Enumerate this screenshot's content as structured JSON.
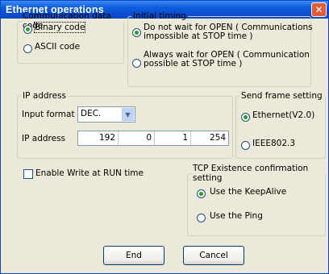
{
  "window": {
    "title": "Ethernet operations",
    "close_glyph": "✕"
  },
  "communication": {
    "legend": "Communication data code",
    "options": [
      "Binary code",
      "ASCII code"
    ],
    "selected": "Binary code"
  },
  "initial_timing": {
    "legend": "Initial timing",
    "options": [
      {
        "line1": "Do not wait for OPEN ( Communications",
        "line2": "impossible at STOP time )"
      },
      {
        "line1": "Always wait for OPEN ( Communication",
        "line2": "possible at STOP time )"
      }
    ],
    "selected_index": 0
  },
  "ip_address": {
    "legend": "IP address",
    "input_format_label": "Input format",
    "input_format_value": "DEC.",
    "ip_label": "IP address",
    "octets": [
      "192",
      "0",
      "1",
      "254"
    ]
  },
  "send_frame": {
    "legend": "Send frame setting",
    "options": [
      "Ethernet(V2.0)",
      "IEEE802.3"
    ],
    "selected": "Ethernet(V2.0)"
  },
  "enable_write": {
    "label": "Enable Write at RUN time",
    "checked": false
  },
  "tcp": {
    "legend": "TCP Existence confirmation setting",
    "options": [
      "Use the KeepAlive",
      "Use the Ping"
    ],
    "selected": "Use the KeepAlive"
  },
  "buttons": {
    "end": "End",
    "cancel": "Cancel"
  },
  "icons": {
    "close": "close-icon",
    "dropdown": "chevron-down-icon"
  }
}
